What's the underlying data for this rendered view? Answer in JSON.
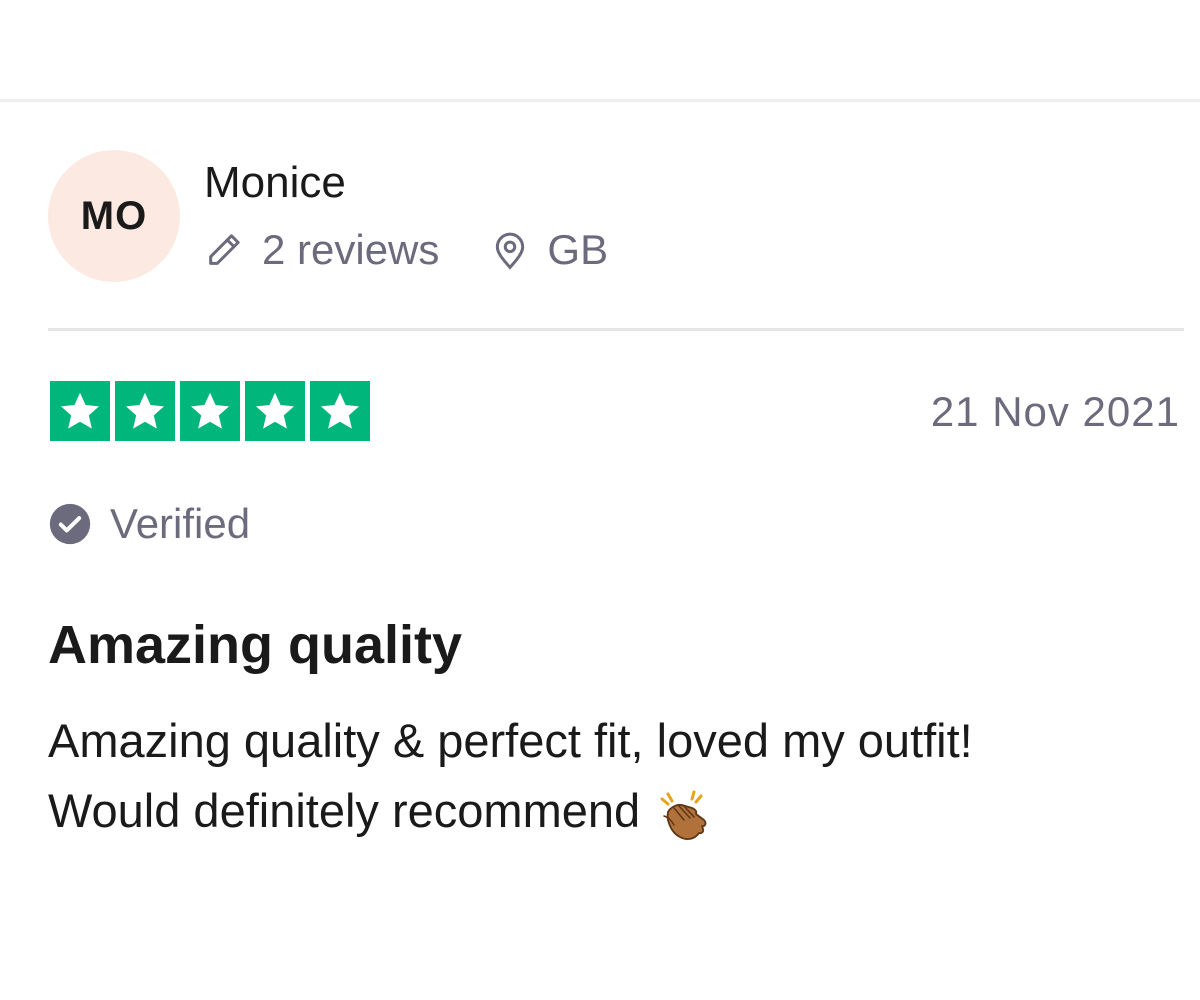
{
  "reviewer": {
    "initials": "MO",
    "name": "Monice",
    "reviews_count": "2 reviews",
    "country": "GB",
    "avatar_color": "#fbe9e2"
  },
  "review": {
    "rating": 5,
    "max_rating": 5,
    "star_color": "#00b67a",
    "date": "21 Nov 2021",
    "verified_label": "Verified",
    "title": "Amazing quality",
    "body_lines": [
      "Amazing quality & perfect fit, loved my outfit!",
      "Would definitely recommend"
    ],
    "body_emoji": "clapping-hands-icon"
  },
  "icons": {
    "reviews": "pencil-icon",
    "location": "location-pin-icon",
    "verified": "verified-check-icon",
    "star": "star-icon"
  },
  "colors": {
    "text_primary": "#1a1a1a",
    "text_secondary": "#6b6b7d",
    "divider": "#e5e5e8"
  }
}
